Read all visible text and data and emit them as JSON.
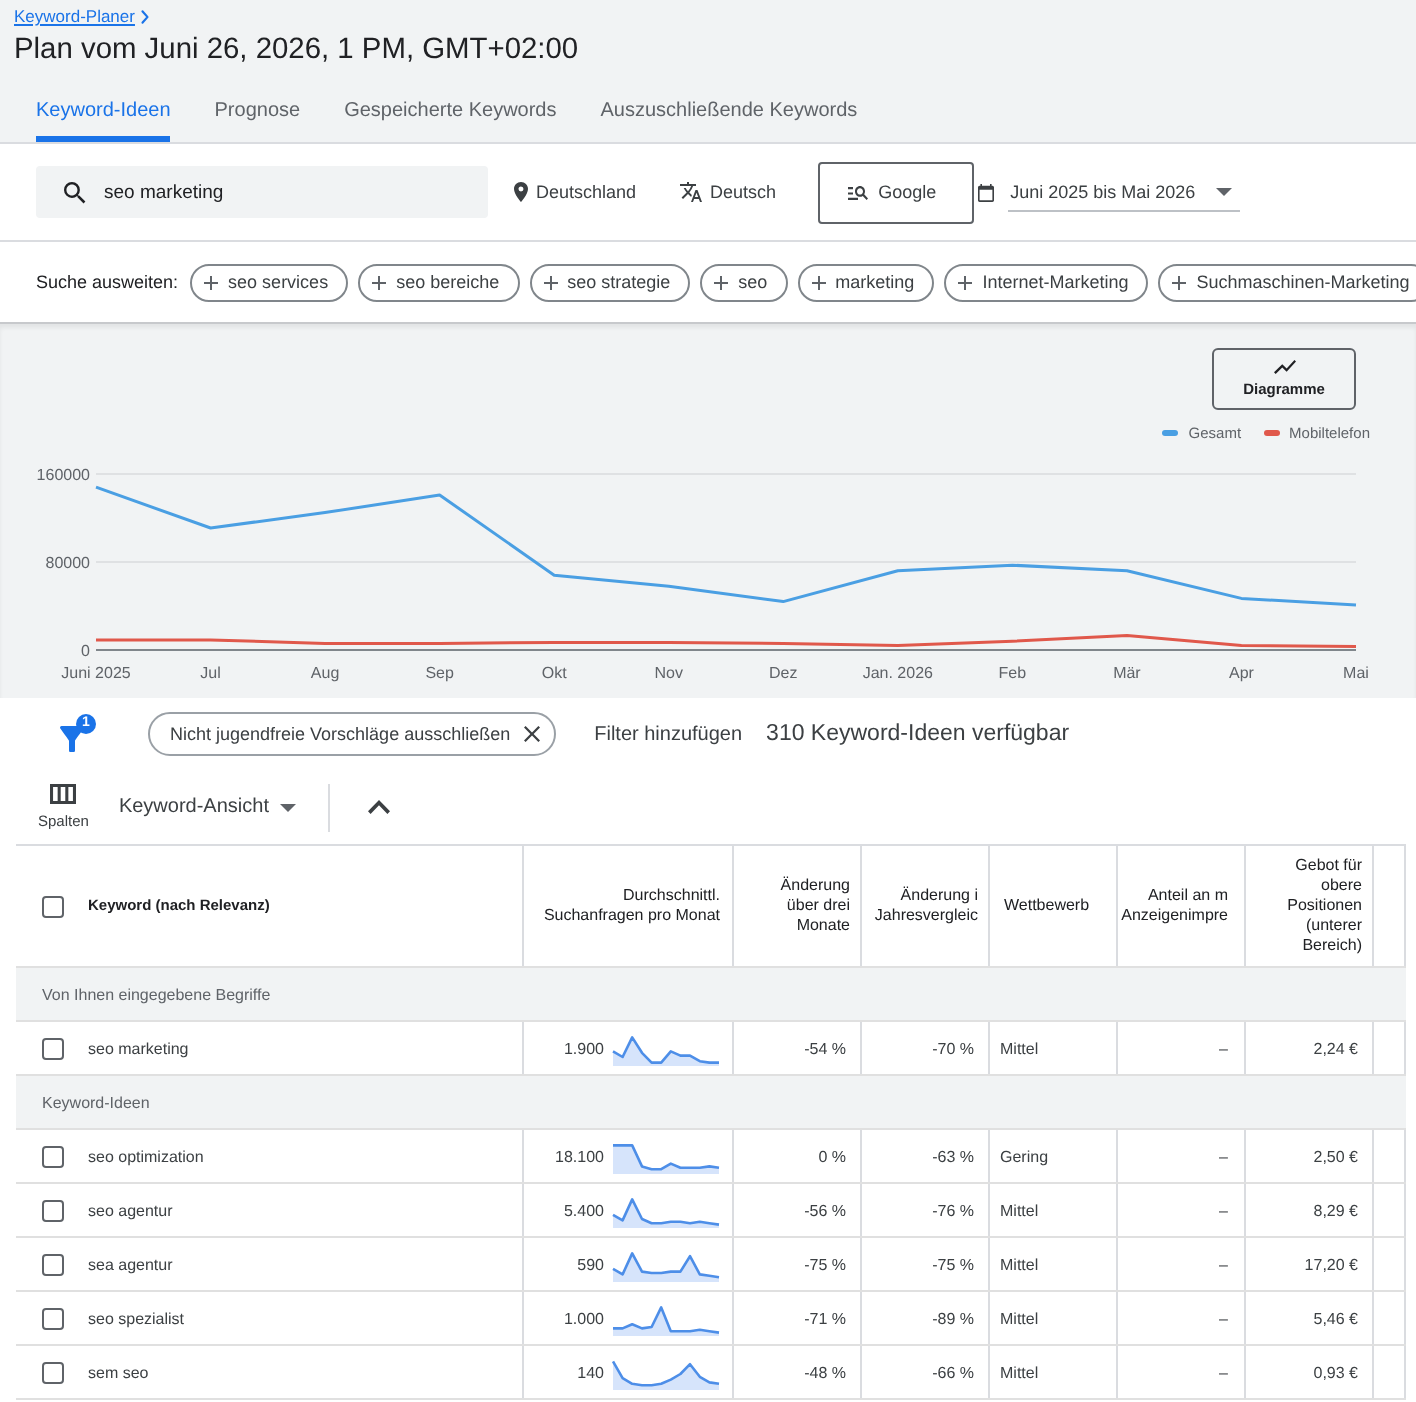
{
  "breadcrumb": {
    "label": "Keyword-Planer"
  },
  "title": "Plan vom Juni 26, 2026, 1 PM, GMT+02:00",
  "tabs": [
    {
      "label": "Keyword-Ideen",
      "selected": true
    },
    {
      "label": "Prognose",
      "selected": false
    },
    {
      "label": "Gespeicherte Keywords",
      "selected": false
    },
    {
      "label": "Auszuschließende Keywords",
      "selected": false
    }
  ],
  "search_bar": {
    "query": "seo marketing",
    "location": "Deutschland",
    "language": "Deutsch",
    "network": "Google",
    "date_range": "Juni 2025 bis Mai 2026"
  },
  "broaden_search": {
    "label": "Suche ausweiten:",
    "suggestions": [
      "seo services",
      "seo bereiche",
      "seo strategie",
      "seo",
      "marketing",
      "Internet-Marketing",
      "Suchmaschinen-Marketing"
    ]
  },
  "trend_chart": {
    "button": "Diagramme",
    "chart_data": {
      "type": "line",
      "categories": [
        "Juni 2025",
        "Jul",
        "Aug",
        "Sep",
        "Okt",
        "Nov",
        "Dez",
        "Jan. 2026",
        "Feb",
        "Mär",
        "Apr",
        "Mai"
      ],
      "series": [
        {
          "name": "Gesamt",
          "color": "#4a9fe3",
          "values": [
            148000,
            111000,
            125000,
            141000,
            68000,
            58000,
            44000,
            72000,
            77000,
            72000,
            47000,
            41000
          ]
        },
        {
          "name": "Mobiltelefon",
          "color": "#e0584b",
          "values": [
            9000,
            9000,
            6000,
            6000,
            7000,
            7000,
            6000,
            4000,
            8000,
            13000,
            4000,
            3000
          ]
        }
      ],
      "ylim": [
        0,
        160000
      ],
      "yticks": [
        0,
        80000,
        160000
      ]
    }
  },
  "filter_bar": {
    "filter_count": "1",
    "active_filter": "Nicht jugendfreie Vorschläge ausschließen",
    "add_filter": "Filter hinzufügen",
    "result_count": "310 Keyword-Ideen verfügbar"
  },
  "toolbar": {
    "columns_button": "Spalten",
    "view": "Keyword-Ansicht"
  },
  "table": {
    "select_all": {
      "checked": false
    },
    "columns": [
      "Keyword (nach Relevanz)",
      "Durchschnittl. Suchanfragen pro Monat",
      "Änderung über drei Monate",
      "Änderung i Jahresvergleic",
      "Wettbewerb",
      "Anteil an m Anzeigenimpre",
      "Gebot für obere Positionen (unterer Bereich)"
    ],
    "groups": [
      {
        "title": "Von Ihnen eingegebene Begriffe",
        "rows": [
          {
            "checked": false,
            "keyword": "seo marketing",
            "avg_monthly_searches": "1.900",
            "three_month_change": "-54 %",
            "yoy_change": "-70 %",
            "competition": "Mittel",
            "impression_share": "–",
            "top_of_page_bid_low": "2,24 €"
          }
        ]
      },
      {
        "title": "Keyword-Ideen",
        "rows": [
          {
            "checked": false,
            "keyword": "seo optimization",
            "avg_monthly_searches": "18.100",
            "three_month_change": "0 %",
            "yoy_change": "-63 %",
            "competition": "Gering",
            "impression_share": "–",
            "top_of_page_bid_low": "2,50 €"
          },
          {
            "checked": false,
            "keyword": "seo agentur",
            "avg_monthly_searches": "5.400",
            "three_month_change": "-56 %",
            "yoy_change": "-76 %",
            "competition": "Mittel",
            "impression_share": "–",
            "top_of_page_bid_low": "8,29 €"
          },
          {
            "checked": false,
            "keyword": "sea agentur",
            "avg_monthly_searches": "590",
            "three_month_change": "-75 %",
            "yoy_change": "-75 %",
            "competition": "Mittel",
            "impression_share": "–",
            "top_of_page_bid_low": "17,20 €"
          },
          {
            "checked": false,
            "keyword": "seo spezialist",
            "avg_monthly_searches": "1.000",
            "three_month_change": "-71 %",
            "yoy_change": "-89 %",
            "competition": "Mittel",
            "impression_share": "–",
            "top_of_page_bid_low": "5,46 €"
          },
          {
            "checked": false,
            "keyword": "sem seo",
            "avg_monthly_searches": "140",
            "three_month_change": "-48 %",
            "yoy_change": "-66 %",
            "competition": "Mittel",
            "impression_share": "–",
            "top_of_page_bid_low": "0,93 €"
          }
        ]
      }
    ]
  }
}
